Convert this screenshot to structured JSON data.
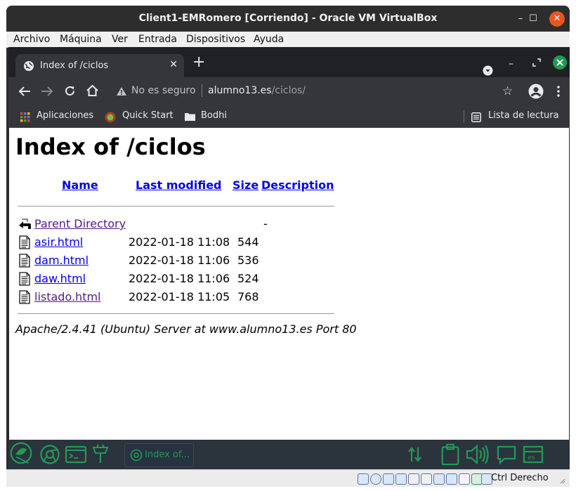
{
  "window": {
    "title": "Client1-EMRomero [Corriendo] - Oracle VM VirtualBox",
    "minimize_icon": "minimize-icon",
    "maximize_icon": "maximize-icon",
    "close_icon": "close-icon"
  },
  "menubar": {
    "items": [
      "Archivo",
      "Máquina",
      "Ver",
      "Entrada",
      "Dispositivos",
      "Ayuda"
    ]
  },
  "browser": {
    "tab": {
      "title": "Index of /ciclos",
      "close": "✕"
    },
    "new_tab": "+",
    "omnibox": {
      "security_text": "No es seguro",
      "url_host": "alumno13.es",
      "url_path": "/ciclos/"
    },
    "bookmarks": {
      "apps": "Aplicaciones",
      "quick_start": "Quick Start",
      "bodhi": "Bodhi",
      "reading_list": "Lista de lectura"
    }
  },
  "page": {
    "heading": "Index of /ciclos",
    "columns": {
      "name": "Name",
      "last_modified": "Last modified",
      "size": "Size",
      "description": "Description"
    },
    "rows": [
      {
        "name": "Parent Directory",
        "modified": "",
        "size": "-",
        "icon": "back-icon"
      },
      {
        "name": "asir.html",
        "modified": "2022-01-18 11:08",
        "size": "544",
        "icon": "file-icon"
      },
      {
        "name": "dam.html",
        "modified": "2022-01-18 11:06",
        "size": "536",
        "icon": "file-icon"
      },
      {
        "name": "daw.html",
        "modified": "2022-01-18 11:06",
        "size": "524",
        "icon": "file-icon"
      },
      {
        "name": "listado.html",
        "modified": "2022-01-18 11:05",
        "size": "768",
        "icon": "file-icon"
      }
    ],
    "address": "Apache/2.4.41 (Ubuntu) Server at www.alumno13.es Port 80"
  },
  "taskbar": {
    "window_label": "Index of..."
  },
  "statusbar": {
    "host_key": "Ctrl Derecho"
  },
  "colors": {
    "titlebar": "#2d2d2d",
    "close_button": "#e95420",
    "browser_dark": "#35363a",
    "link": "#0000ee",
    "visited_link": "#551a8b",
    "taskbar_green": "#1f9b54",
    "taskbar_bg": "#2b333d"
  }
}
